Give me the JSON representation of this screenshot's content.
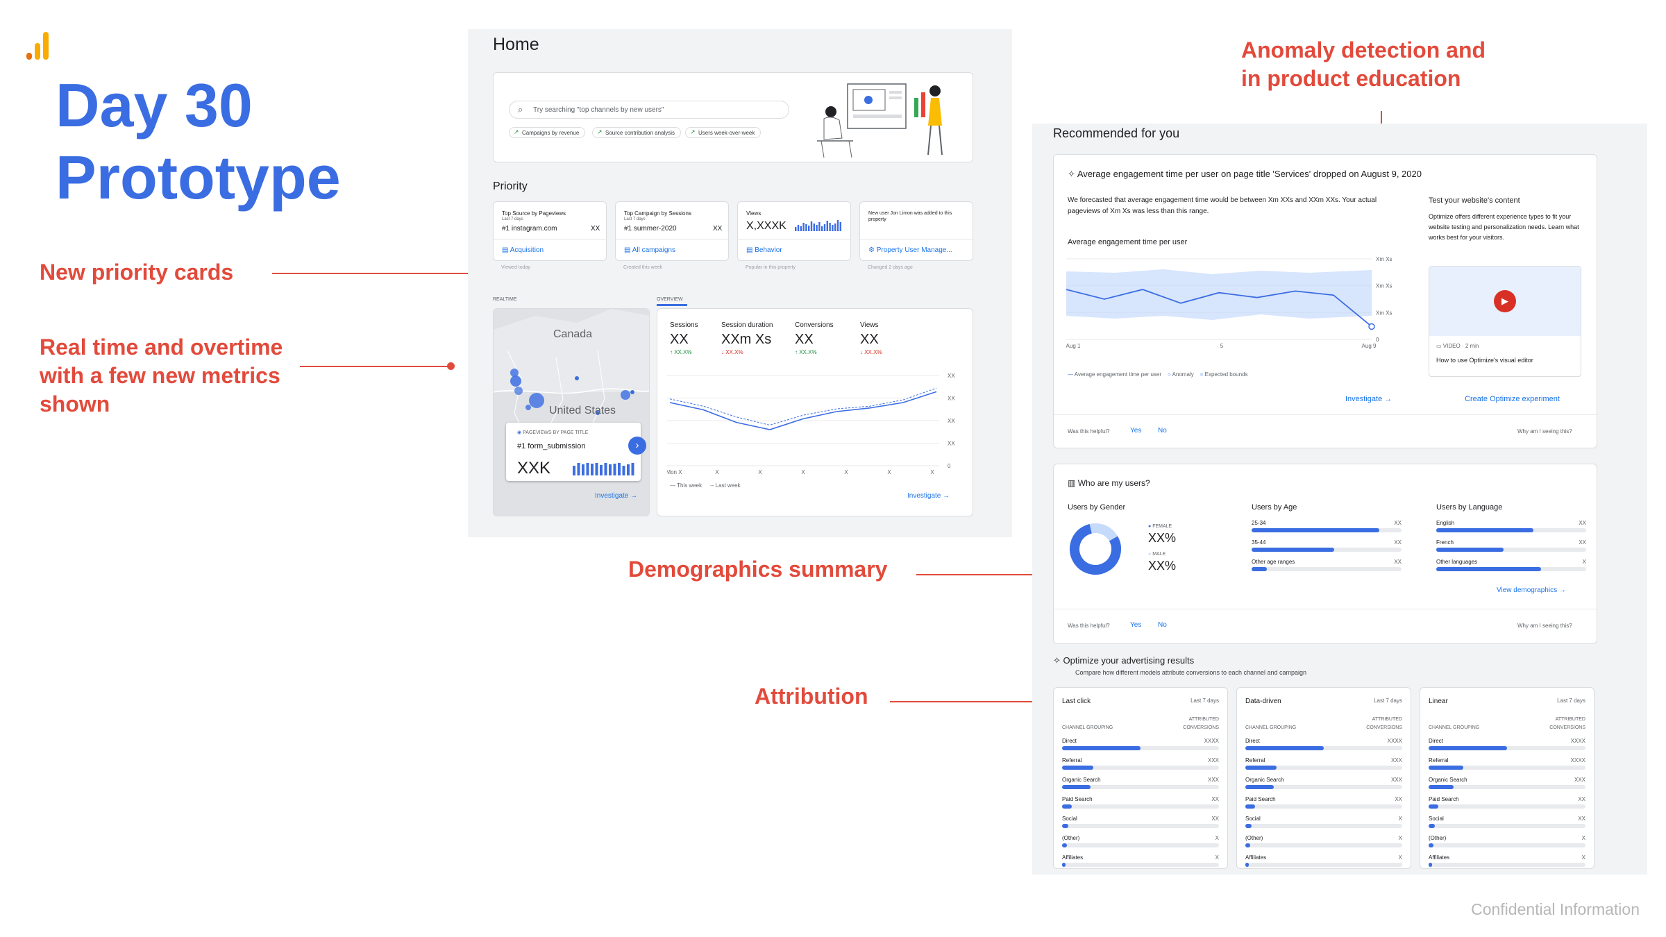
{
  "slide": {
    "title_line1": "Day 30",
    "title_line2": "Prototype",
    "confidential": "Confidential Information",
    "accent": "#3b6de2",
    "callout_color": "#e24a3b",
    "logo_icon": "analytics-bars-icon"
  },
  "callouts": {
    "priority": "New priority cards",
    "realtime_l1": "Real time and overtime",
    "realtime_l2": "with a few new metrics",
    "realtime_l3": "shown",
    "anomaly_l1": "Anomaly detection and",
    "anomaly_l2": "in product education",
    "demographics": "Demographics summary",
    "attribution": "Attribution"
  },
  "home": {
    "title": "Home",
    "search_placeholder": "Try searching \"top channels by new users\"",
    "chips": [
      "Campaigns by revenue",
      "Source contribution analysis",
      "Users week-over-week"
    ],
    "priority_title": "Priority",
    "priority_cards": [
      {
        "label": "Top Source by Pageviews",
        "sub": "Last 7 days",
        "value": "#1 instagram.com",
        "val2": "XX",
        "link": "Acquisition",
        "foot": "Viewed today"
      },
      {
        "label": "Top Campaign by Sessions",
        "sub": "Last 7 days",
        "value": "#1 summer-2020",
        "val2": "XX",
        "link": "All campaigns",
        "foot": "Created this week"
      },
      {
        "label": "Views",
        "sub": "",
        "value": "X,XXXK",
        "val2": "",
        "link": "Behavior",
        "foot": "Popular in this property"
      },
      {
        "label": "New user Jon Limon was added to this property",
        "sub": "",
        "value": "",
        "val2": "",
        "link": "Property User Manage...",
        "foot": "Changed 2 days ago"
      }
    ],
    "realtime_label": "REALTIME",
    "overview_label": "OVERVIEW",
    "map_canada": "Canada",
    "map_us": "United States",
    "pageviews_label": "PAGEVIEWS BY PAGE TITLE",
    "pageviews_item": "#1 form_submission",
    "pageviews_value": "XXK",
    "investigate": "Investigate →",
    "overview_metrics": [
      {
        "label": "Sessions",
        "value": "XX",
        "delta": "↑ XX.X%",
        "up": true
      },
      {
        "label": "Session duration",
        "value": "XXm Xs",
        "delta": "↓ XX.X%",
        "up": false
      },
      {
        "label": "Conversions",
        "value": "XX",
        "delta": "↑ XX.X%",
        "up": true
      },
      {
        "label": "Views",
        "value": "XX",
        "delta": "↓ XX.X%",
        "up": false
      }
    ],
    "overview_y_ticks": [
      "XX",
      "XX",
      "XX",
      "XX",
      "0"
    ],
    "overview_x_ticks": [
      "Mon X",
      "X",
      "X",
      "X",
      "X",
      "X",
      "X"
    ],
    "legend_this": "— This week",
    "legend_last": "-- Last week"
  },
  "recommended": {
    "title": "Recommended for you",
    "anomaly_title": "Average engagement time per user on page title 'Services' dropped on August 9, 2020",
    "anomaly_body": "We forecasted that average engagement time would be between Xm XXs and XXm XXs. Your actual pageviews of Xm Xs was less than this range.",
    "chart_title": "Average engagement time per user",
    "y_ticks": [
      "Xm Xs",
      "Xm Xs",
      "Xm Xs",
      "0"
    ],
    "x_ticks": [
      "Aug 1",
      "5",
      "Aug 9"
    ],
    "legend": [
      "Average engagement time per user",
      "Anomaly",
      "Expected bounds"
    ],
    "investigate": "Investigate →",
    "edu_title": "Test your website's content",
    "edu_body": "Optimize offers different experience types to fit your website testing and personalization needs. Learn what works best for your visitors.",
    "video_label": "VIDEO",
    "video_len": "2 min",
    "video_title": "How to use Optimize's visual editor",
    "create_exp": "Create Optimize experiment",
    "helpful": "Was this helpful?",
    "yes": "Yes",
    "no": "No",
    "why": "Why am I seeing this?"
  },
  "users": {
    "title": "Who are my users?",
    "gender_title": "Users by Gender",
    "female_label": "FEMALE",
    "female_value": "XX%",
    "male_label": "MALE",
    "male_value": "XX%",
    "age_title": "Users by Age",
    "age_rows": [
      {
        "label": "25-34",
        "value": "XX",
        "fill": 0.85
      },
      {
        "label": "35-44",
        "value": "XX",
        "fill": 0.55
      },
      {
        "label": "Other age ranges",
        "value": "XX",
        "fill": 0.1
      }
    ],
    "lang_title": "Users by Language",
    "lang_rows": [
      {
        "label": "English",
        "value": "XX",
        "fill": 0.65
      },
      {
        "label": "French",
        "value": "XX",
        "fill": 0.45
      },
      {
        "label": "Other languages",
        "value": "X",
        "fill": 0.7
      }
    ],
    "view_demo": "View demographics →",
    "helpful": "Was this helpful?",
    "yes": "Yes",
    "no": "No",
    "why": "Why am I seeing this?"
  },
  "optimize": {
    "title": "Optimize your advertising results",
    "subtitle": "Compare how different models attribute conversions to each channel and campaign",
    "col_channel": "CHANNEL GROUPING",
    "col_attr_1": "ATTRIBUTED",
    "col_attr_2": "CONVERSIONS",
    "models": [
      {
        "name": "Last click",
        "range": "Last 7 days",
        "rows": [
          {
            "label": "Direct",
            "value": "XXXX",
            "fill": 0.5
          },
          {
            "label": "Referral",
            "value": "XXX",
            "fill": 0.2
          },
          {
            "label": "Organic Search",
            "value": "XXX",
            "fill": 0.18
          },
          {
            "label": "Paid Search",
            "value": "XX",
            "fill": 0.06
          },
          {
            "label": "Social",
            "value": "XX",
            "fill": 0.04
          },
          {
            "label": "(Other)",
            "value": "X",
            "fill": 0.03
          },
          {
            "label": "Affiliates",
            "value": "X",
            "fill": 0.02
          }
        ]
      },
      {
        "name": "Data-driven",
        "range": "Last 7 days",
        "rows": [
          {
            "label": "Direct",
            "value": "XXXX",
            "fill": 0.5
          },
          {
            "label": "Referral",
            "value": "XXX",
            "fill": 0.2
          },
          {
            "label": "Organic Search",
            "value": "XXX",
            "fill": 0.18
          },
          {
            "label": "Paid Search",
            "value": "XX",
            "fill": 0.06
          },
          {
            "label": "Social",
            "value": "X",
            "fill": 0.04
          },
          {
            "label": "(Other)",
            "value": "X",
            "fill": 0.03
          },
          {
            "label": "Affiliates",
            "value": "X",
            "fill": 0.02
          }
        ]
      },
      {
        "name": "Linear",
        "range": "Last 7 days",
        "rows": [
          {
            "label": "Direct",
            "value": "XXXX",
            "fill": 0.5
          },
          {
            "label": "Referral",
            "value": "XXXX",
            "fill": 0.22
          },
          {
            "label": "Organic Search",
            "value": "XXX",
            "fill": 0.16
          },
          {
            "label": "Paid Search",
            "value": "XX",
            "fill": 0.06
          },
          {
            "label": "Social",
            "value": "XX",
            "fill": 0.04
          },
          {
            "label": "(Other)",
            "value": "X",
            "fill": 0.03
          },
          {
            "label": "Affiliates",
            "value": "X",
            "fill": 0.02
          }
        ]
      }
    ]
  }
}
